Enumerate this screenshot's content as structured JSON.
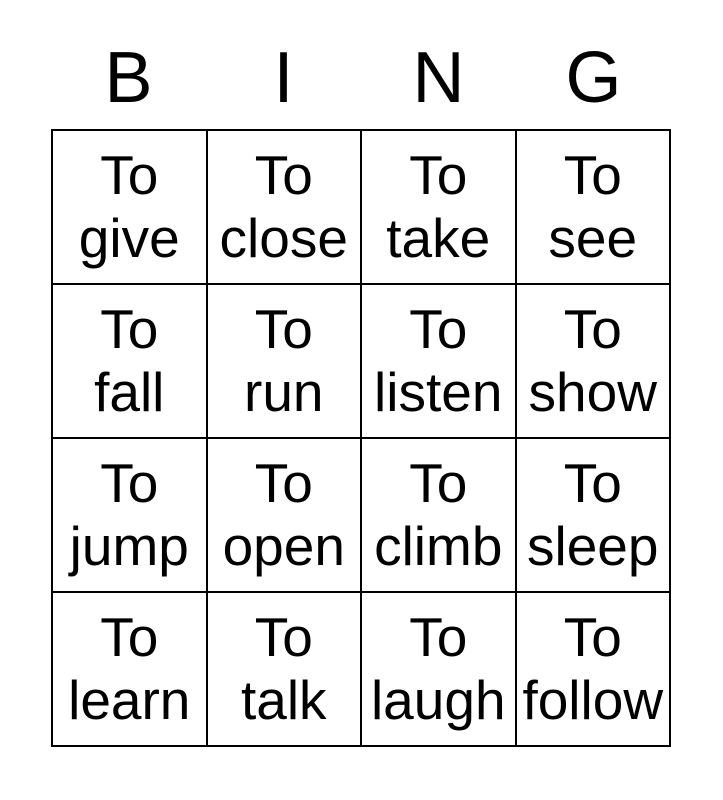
{
  "card": {
    "type": "bingo-card",
    "columns": 4,
    "rows": 4,
    "background_color": "#ffffff",
    "text_color": "#000000",
    "border_color": "#000000"
  },
  "header": {
    "letters": [
      {
        "label": "B"
      },
      {
        "label": "I"
      },
      {
        "label": "N"
      },
      {
        "label": "G"
      }
    ]
  },
  "grid": {
    "cells": [
      {
        "line1": "To",
        "line2": "give",
        "text": "To give"
      },
      {
        "line1": "To",
        "line2": "close",
        "text": "To close"
      },
      {
        "line1": "To",
        "line2": "take",
        "text": "To take"
      },
      {
        "line1": "To",
        "line2": "see",
        "text": "To see"
      },
      {
        "line1": "To",
        "line2": "fall",
        "text": "To fall"
      },
      {
        "line1": "To",
        "line2": "run",
        "text": "To run"
      },
      {
        "line1": "To",
        "line2": "listen",
        "text": "To listen"
      },
      {
        "line1": "To",
        "line2": "show",
        "text": "To show"
      },
      {
        "line1": "To",
        "line2": "jump",
        "text": "To jump"
      },
      {
        "line1": "To",
        "line2": "open",
        "text": "To open"
      },
      {
        "line1": "To",
        "line2": "climb",
        "text": "To climb"
      },
      {
        "line1": "To",
        "line2": "sleep",
        "text": "To sleep"
      },
      {
        "line1": "To",
        "line2": "learn",
        "text": "To learn"
      },
      {
        "line1": "To",
        "line2": "talk",
        "text": "To talk"
      },
      {
        "line1": "To",
        "line2": "laugh",
        "text": "To laugh"
      },
      {
        "line1": "To",
        "line2": "follow",
        "text": "To follow"
      }
    ]
  }
}
